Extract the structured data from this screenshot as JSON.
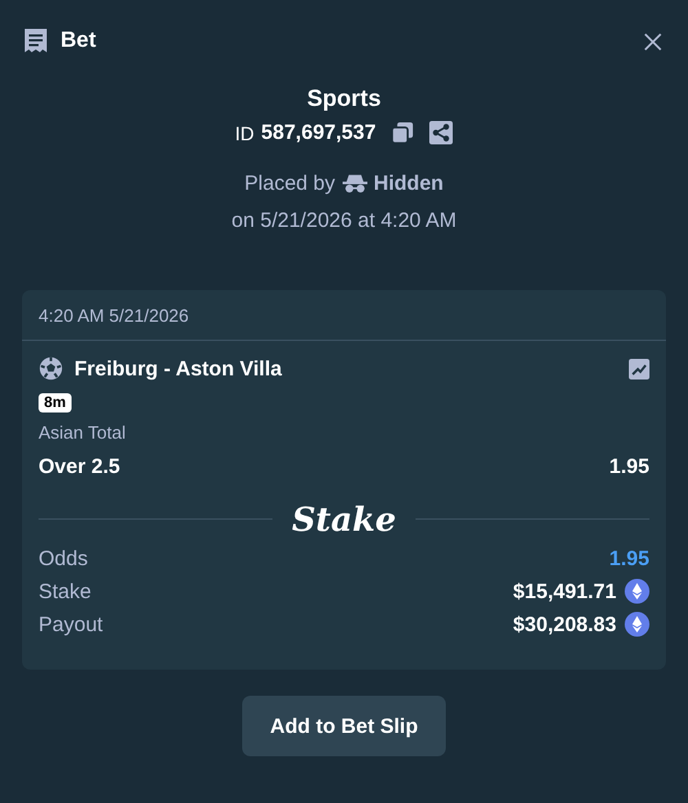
{
  "header": {
    "title": "Bet"
  },
  "bet": {
    "category": "Sports",
    "id_label": "ID",
    "id_value": "587,697,537",
    "placed_by_label": "Placed by",
    "user": "Hidden",
    "placed_on": "on 5/21/2026 at 4:20 AM"
  },
  "card": {
    "timestamp": "4:20 AM 5/21/2026",
    "event": "Freiburg - Aston Villa",
    "live_badge": "8m",
    "market": "Asian Total",
    "selection": "Over 2.5",
    "selection_odds": "1.95",
    "brand": "Stake",
    "stats": [
      {
        "kind": "odds",
        "label": "Odds",
        "value": "1.95"
      },
      {
        "kind": "amount",
        "label": "Stake",
        "value": "$15,491.71"
      },
      {
        "kind": "amount",
        "label": "Payout",
        "value": "$30,208.83"
      }
    ]
  },
  "button": "Add to Bet Slip"
}
